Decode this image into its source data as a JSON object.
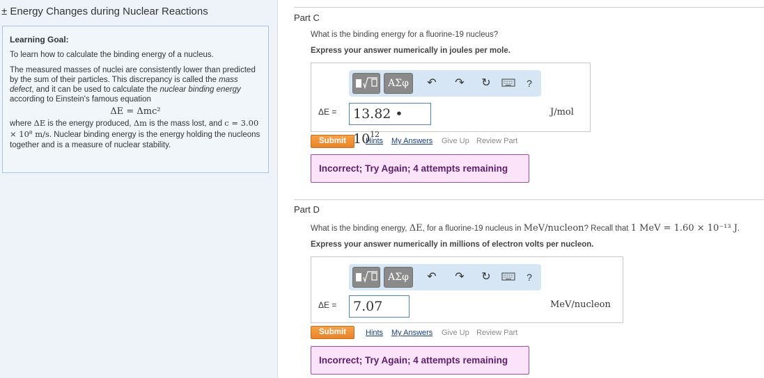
{
  "sidebar": {
    "title": "± Energy Changes during Nuclear Reactions",
    "goal_label": "Learning Goal:",
    "goal_text": "To learn how to calculate the binding energy of a nucleus.",
    "p2_a": "The measured masses of nuclei are consistently lower than predicted by the sum of their particles. This discrepancy is called the ",
    "p2_em1": "mass defect",
    "p2_b": ", and it can be used to calculate the ",
    "p2_em2": "nuclear binding energy",
    "p2_c": " according to Einstein's famous equation",
    "equation": "ΔE = Δmc²",
    "p3_a": "where ",
    "p3_m1": "ΔE",
    "p3_b": " is the energy produced, ",
    "p3_m2": "Δm",
    "p3_c": " is the mass lost, and ",
    "p3_m3": "c = 3.00 × 10⁸ m/s",
    "p3_d": ". Nuclear binding energy is the energy holding the nucleons together and is a measure of nuclear stability."
  },
  "toolbar": {
    "greek_label": "ΑΣφ",
    "help_label": "?",
    "icons": [
      "templates-icon",
      "greek-letters-icon",
      "undo-icon",
      "redo-icon",
      "reset-icon",
      "keyboard-icon",
      "help-icon"
    ]
  },
  "links": {
    "submit": "Submit",
    "hints": "Hints",
    "my_answers": "My Answers",
    "give_up": "Give Up",
    "review_part": "Review Part"
  },
  "partC": {
    "label": "Part C",
    "question": "What is the binding energy for a fluorine-19 nucleus?",
    "instruction": "Express your answer numerically in joules per mole.",
    "var_label": "ΔE =",
    "answer_mantissa": "13.82 • 10",
    "answer_exponent": "12",
    "unit": "J/mol",
    "feedback": "Incorrect; Try Again; 4 attempts remaining"
  },
  "partD": {
    "label": "Part D",
    "question_a": "What is the binding energy, ",
    "question_m1": "ΔE",
    "question_b": ", for a fluorine-19 nucleus in ",
    "question_m2": "MeV/nucleon",
    "question_c": "? Recall that ",
    "question_m3": "1 MeV = 1.60 × 10⁻¹³ J",
    "question_d": ".",
    "instruction": "Express your answer numerically in millions of electron volts per nucleon.",
    "var_label": "ΔE =",
    "answer": "7.07",
    "unit": "MeV/nucleon",
    "feedback": "Incorrect; Try Again; 4 attempts remaining"
  },
  "colors": {
    "submit_orange": "#e8842a",
    "feedback_bg": "#fbe4fa",
    "feedback_text": "#5b1f6a",
    "toolbar_bg": "#d6e6f5",
    "field_border": "#4f81bd"
  }
}
